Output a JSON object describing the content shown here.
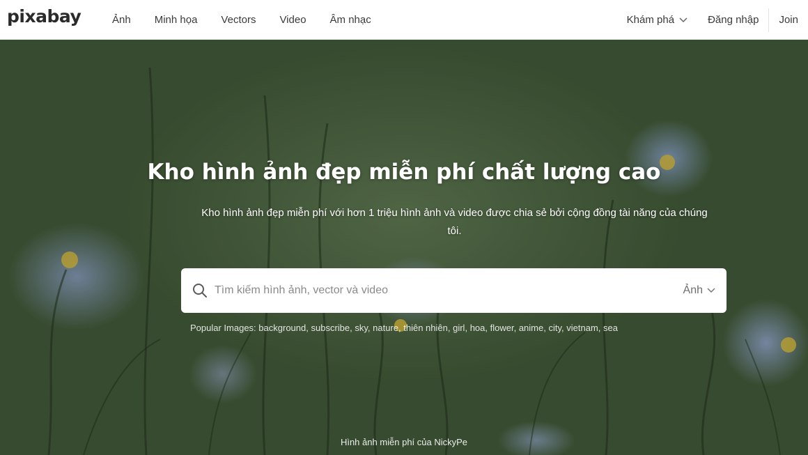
{
  "header": {
    "logo": "pixabay",
    "nav": [
      "Ảnh",
      "Minh họa",
      "Vectors",
      "Video",
      "Âm nhạc"
    ],
    "explore": "Khám phá",
    "login": "Đăng nhập",
    "join": "Join"
  },
  "hero": {
    "title": "Kho hình ảnh đẹp miễn phí chất lượng cao",
    "subtitle": "Kho hình ảnh đẹp miễn phí với hơn 1 triệu hình ảnh và video được chia sẻ bởi cộng đồng tài năng của chúng tôi.",
    "search": {
      "placeholder": "Tìm kiếm hình ảnh, vector và video",
      "value": "",
      "type": "Ảnh",
      "icon": "search-icon"
    },
    "popular_label": "Popular Images:",
    "popular_tags": [
      "background",
      "subscribe",
      "sky",
      "nature",
      "thiên nhiên",
      "girl",
      "hoa",
      "flower",
      "anime",
      "city",
      "vietnam",
      "sea"
    ],
    "credit": "Hình ảnh miễn phí của NickyPe"
  },
  "colors": {
    "hero_bg": "#4d6644",
    "flower": "#9fb3dd",
    "text_dark": "#3a3a3a"
  }
}
